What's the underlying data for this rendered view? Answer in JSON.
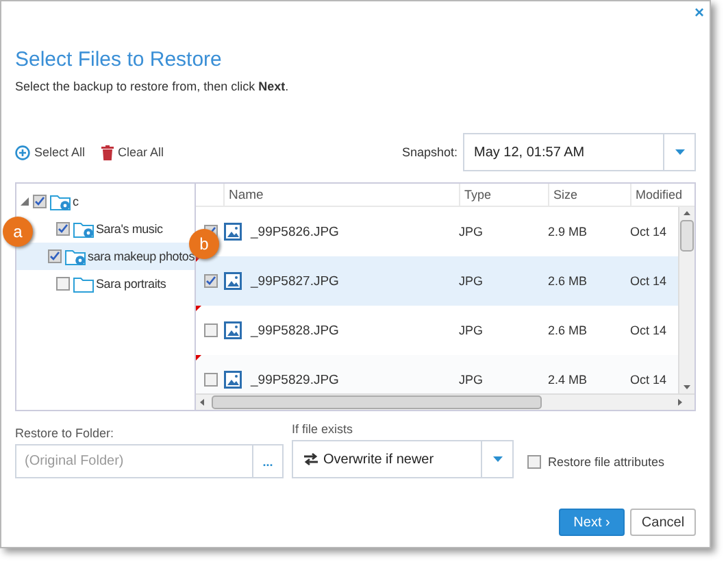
{
  "window": {
    "close": "×",
    "title": "Select Files to Restore",
    "subtitle": "Select the backup to restore from, then click **Next**."
  },
  "toolbar": {
    "select_all": "Select All",
    "clear_all": "Clear All",
    "snapshot_label": "Snapshot:",
    "snapshot_value": "May 12, 01:57 AM"
  },
  "tree": [
    {
      "label": "c",
      "checked": true,
      "selected": false,
      "expanded": true,
      "backup": true,
      "children": [
        {
          "label": "Sara's music",
          "checked": true,
          "selected": false,
          "backup": true
        },
        {
          "label": "sara makeup photos",
          "checked": true,
          "selected": true,
          "backup": true
        },
        {
          "label": "Sara portraits",
          "checked": false,
          "selected": false,
          "backup": false
        }
      ]
    }
  ],
  "files": {
    "columns": [
      "Name",
      "Type",
      "Size",
      "Modified"
    ],
    "rows": [
      {
        "name": "_99P5826.JPG",
        "type": "JPG",
        "size": "2.9 MB",
        "modified": "Oct 14",
        "checked": true,
        "selected": false,
        "flagged": false
      },
      {
        "name": "_99P5827.JPG",
        "type": "JPG",
        "size": "2.6 MB",
        "modified": "Oct 14",
        "checked": true,
        "selected": true,
        "flagged": true
      },
      {
        "name": "_99P5828.JPG",
        "type": "JPG",
        "size": "2.6 MB",
        "modified": "Oct 14",
        "checked": false,
        "selected": false,
        "flagged": true
      },
      {
        "name": "_99P5829.JPG",
        "type": "JPG",
        "size": "2.4 MB",
        "modified": "Oct 14",
        "checked": false,
        "selected": false,
        "flagged": true
      }
    ]
  },
  "restore_to": {
    "label": "Restore to Folder:",
    "placeholder": "(Original Folder)",
    "browse": "..."
  },
  "if_exists": {
    "label": "If file exists",
    "value": "Overwrite if newer"
  },
  "restore_attributes": {
    "label": "Restore file attributes",
    "checked": false
  },
  "buttons": [
    {
      "label": "Next ›",
      "kind": "primary"
    },
    {
      "label": "Cancel",
      "kind": "secondary"
    }
  ],
  "callouts": [
    {
      "label": "a"
    },
    {
      "label": "b"
    }
  ]
}
